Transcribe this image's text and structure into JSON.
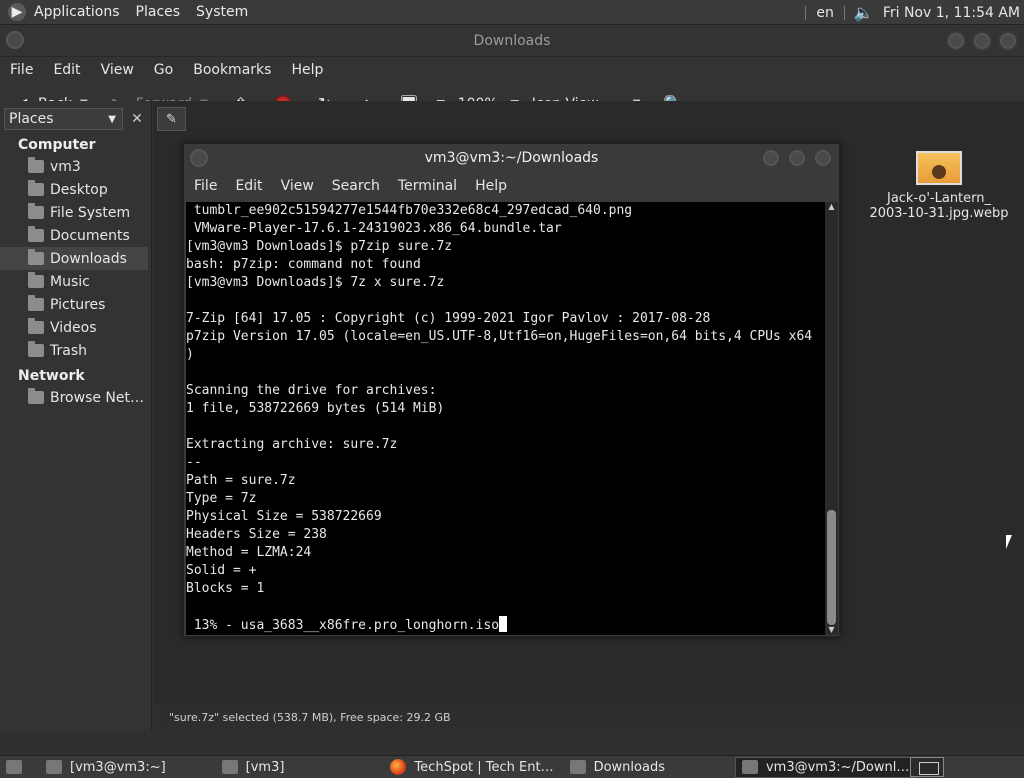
{
  "top_panel": {
    "menu": [
      "Applications",
      "Places",
      "System"
    ],
    "keyboard_layout": "en",
    "clock": "Fri Nov 1, 11:54 AM"
  },
  "file_manager": {
    "title": "Downloads",
    "menu": [
      "File",
      "Edit",
      "View",
      "Go",
      "Bookmarks",
      "Help"
    ],
    "toolbar": {
      "back": "Back",
      "forward": "Forward",
      "zoom": "100%",
      "view_mode": "Icon View"
    },
    "sidebar": {
      "selector": "Places",
      "groups": [
        {
          "label": "Computer",
          "items": [
            "vm3",
            "Desktop",
            "File System",
            "Documents",
            "Downloads",
            "Music",
            "Pictures",
            "Videos",
            "Trash"
          ]
        },
        {
          "label": "Network",
          "items": [
            "Browse Net…"
          ]
        }
      ],
      "active": "Downloads"
    },
    "file": {
      "name_line1": "Jack-o'-Lantern_",
      "name_line2": "2003-10-31.jpg.webp"
    },
    "status": "\"sure.7z\" selected (538.7 MB), Free space: 29.2 GB"
  },
  "terminal": {
    "title": "vm3@vm3:~/Downloads",
    "menu": [
      "File",
      "Edit",
      "View",
      "Search",
      "Terminal",
      "Help"
    ],
    "lines": [
      " tumblr_ee902c51594277e1544fb70e332e68c4_297edcad_640.png",
      " VMware-Player-17.6.1-24319023.x86_64.bundle.tar",
      "[vm3@vm3 Downloads]$ p7zip sure.7z",
      "bash: p7zip: command not found",
      "[vm3@vm3 Downloads]$ 7z x sure.7z",
      "",
      "7-Zip [64] 17.05 : Copyright (c) 1999-2021 Igor Pavlov : 2017-08-28",
      "p7zip Version 17.05 (locale=en_US.UTF-8,Utf16=on,HugeFiles=on,64 bits,4 CPUs x64",
      ")",
      "",
      "Scanning the drive for archives:",
      "1 file, 538722669 bytes (514 MiB)",
      "",
      "Extracting archive: sure.7z",
      "--",
      "Path = sure.7z",
      "Type = 7z",
      "Physical Size = 538722669",
      "Headers Size = 238",
      "Method = LZMA:24",
      "Solid = +",
      "Blocks = 1",
      "",
      " 13% - usa_3683__x86fre.pro_longhorn.iso"
    ]
  },
  "taskbar": {
    "tasks": [
      "[vm3@vm3:~]",
      "[vm3]",
      "TechSpot | Tech Ent…",
      "Downloads",
      "vm3@vm3:~/Downl…"
    ],
    "active_index": 4
  }
}
